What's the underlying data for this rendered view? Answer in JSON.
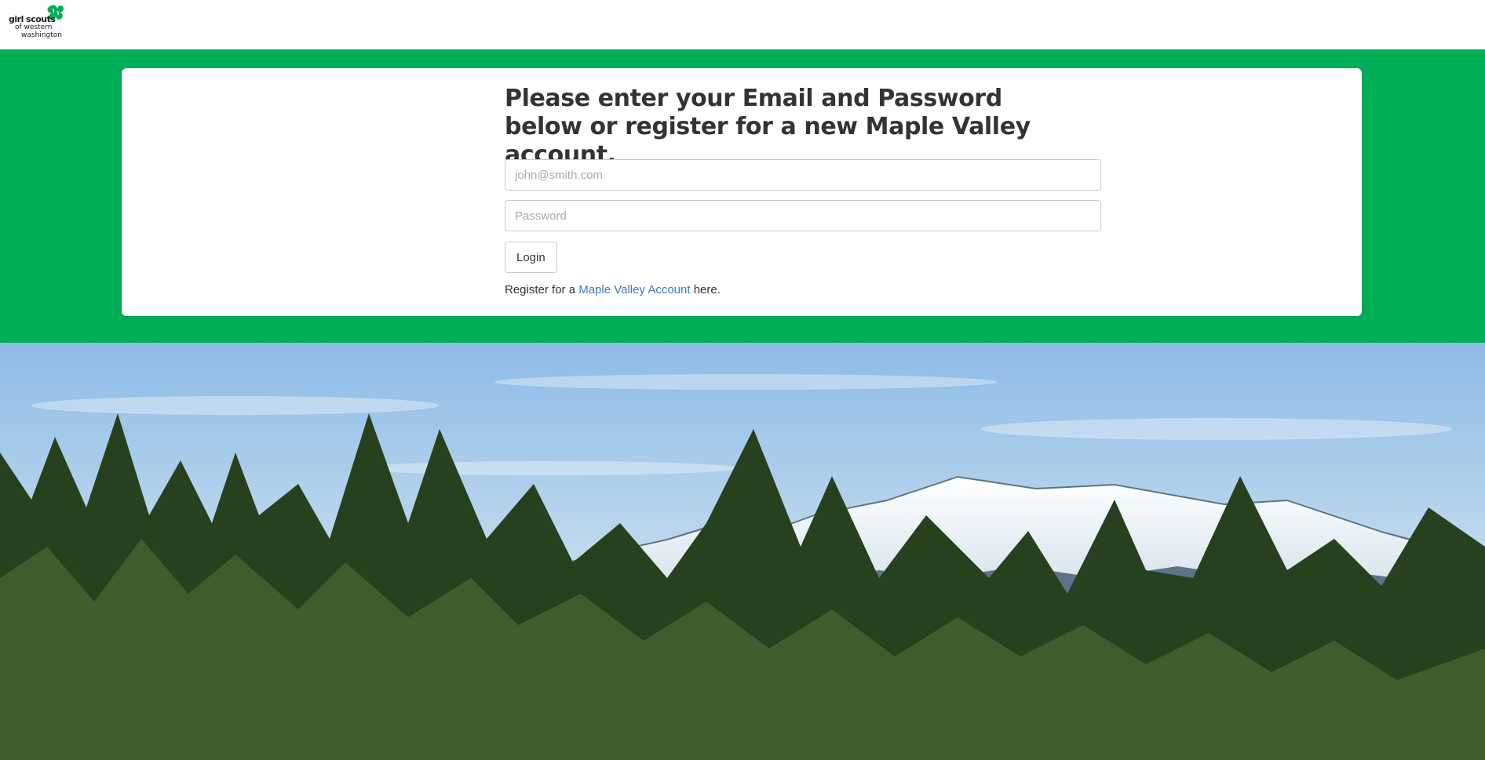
{
  "header": {
    "logo_line1": "girl scouts",
    "logo_line2": "of western",
    "logo_line3": "washington"
  },
  "login": {
    "heading": "Please enter your Email and Password below or register for a new Maple Valley account.",
    "email_placeholder": "john@smith.com",
    "password_placeholder": "Password",
    "login_label": "Login",
    "register_prefix": "Register for a ",
    "register_link": "Maple Valley Account",
    "register_suffix": " here."
  },
  "colors": {
    "brand_green": "#00ae58",
    "link_blue": "#3a79c7"
  },
  "icons": {
    "logo": "trefoil-icon"
  }
}
